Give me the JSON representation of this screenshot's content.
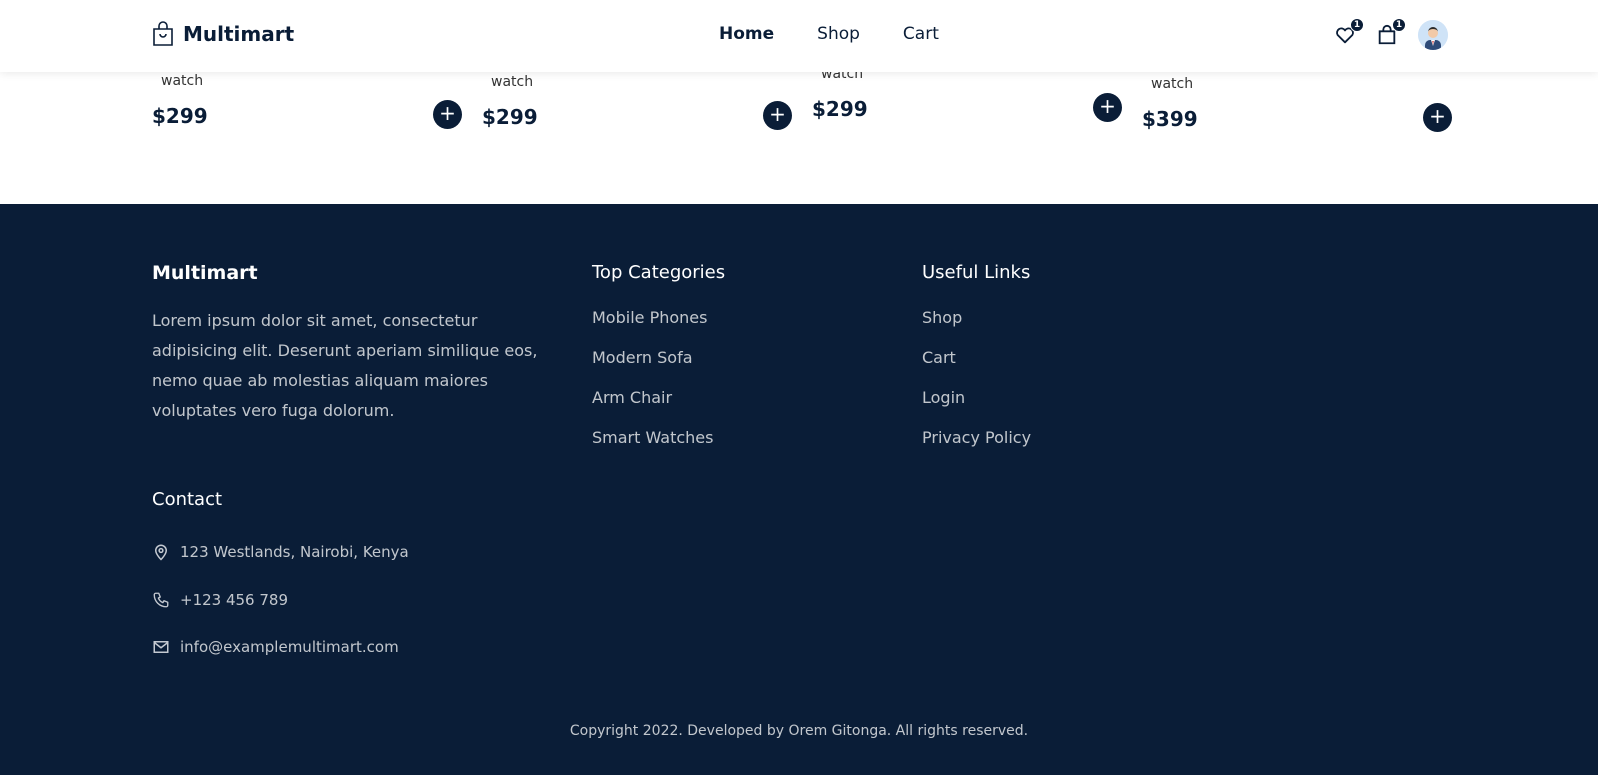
{
  "header": {
    "brand": "Multimart",
    "nav": [
      {
        "label": "Home",
        "active": true
      },
      {
        "label": "Shop",
        "active": false
      },
      {
        "label": "Cart",
        "active": false
      }
    ],
    "wishlist_count": "1",
    "cart_count": "1",
    "icons": {
      "wishlist": "heart-icon",
      "cart": "shopping-bag-icon",
      "profile": "user-avatar"
    }
  },
  "products": [
    {
      "category": "watch",
      "price": "$299",
      "add_label": "+"
    },
    {
      "category": "watch",
      "price": "$299",
      "add_label": "+"
    },
    {
      "category": "watch",
      "price": "$299",
      "add_label": "+"
    },
    {
      "category": "watch",
      "price": "$399",
      "add_label": "+"
    }
  ],
  "footer": {
    "brand": "Multimart",
    "description": "Lorem ipsum dolor sit amet, consectetur adipisicing elit. Deserunt aperiam similique eos, nemo quae ab molestias aliquam maiores voluptates vero fuga dolorum.",
    "contact_title": "Contact",
    "contact": [
      {
        "icon": "map-pin-icon",
        "text": "123 Westlands, Nairobi, Kenya"
      },
      {
        "icon": "phone-icon",
        "text": "+123 456 789"
      },
      {
        "icon": "mail-icon",
        "text": "info@examplemultimart.com"
      }
    ],
    "top_categories_title": "Top Categories",
    "top_categories": [
      "Mobile Phones",
      "Modern Sofa",
      "Arm Chair",
      "Smart Watches"
    ],
    "useful_links_title": "Useful Links",
    "useful_links": [
      "Shop",
      "Cart",
      "Login",
      "Privacy Policy"
    ],
    "copyright": "Copyright 2022. Developed by Orem Gitonga. All rights reserved."
  },
  "colors": {
    "primary": "#0a1d37",
    "background": "#ffffff",
    "footer_text": "#c4c9d1"
  }
}
